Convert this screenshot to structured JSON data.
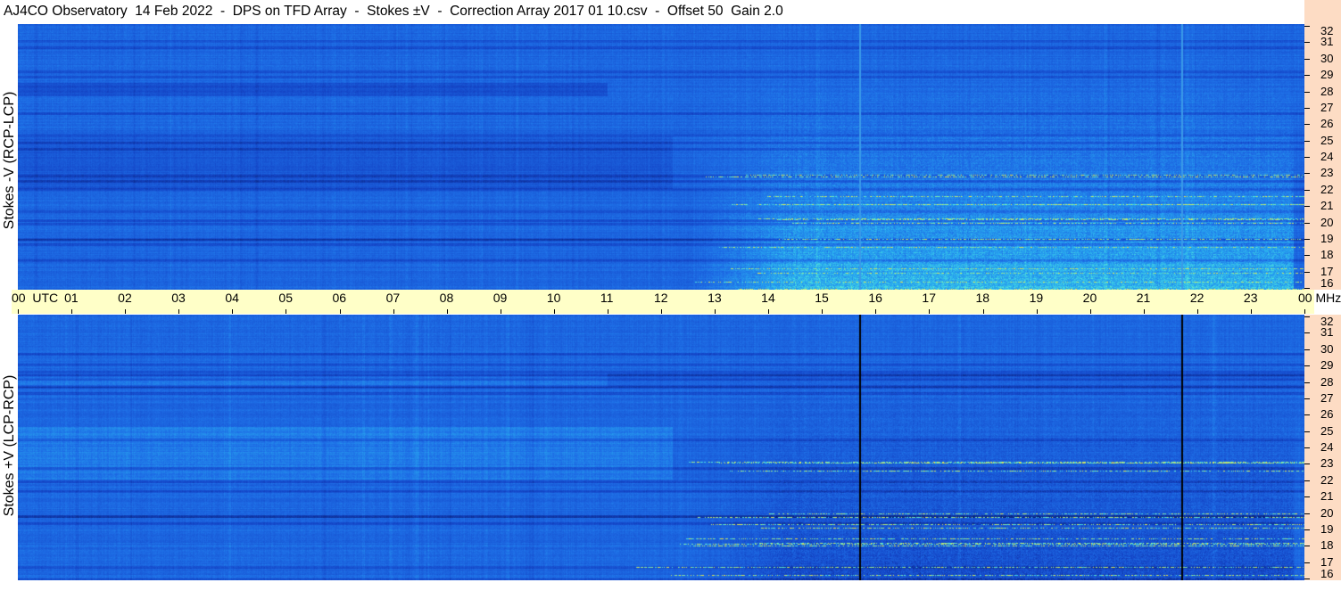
{
  "title": "AJ4CO Observatory  14 Feb 2022  -  DPS on TFD Array  -  Stokes ±V  -  Correction Array 2017 01 10.csv  -  Offset 50  Gain 2.0",
  "colors": {
    "background_blue": "#1a5ad8",
    "time_axis_bg": "#ffffc8",
    "freq_axis_bg": "#fddcc4"
  },
  "time_axis": {
    "labels": [
      "00  UTC",
      "01",
      "02",
      "03",
      "04",
      "05",
      "06",
      "07",
      "08",
      "09",
      "10",
      "11",
      "12",
      "13",
      "14",
      "15",
      "16",
      "17",
      "18",
      "19",
      "20",
      "21",
      "22",
      "23",
      "00 MHz"
    ]
  },
  "chart_data": [
    {
      "type": "heatmap",
      "ylabel": "Stokes -V (RCP-LCP)",
      "x_unit": "UTC hour",
      "x_range": [
        0,
        24
      ],
      "y_unit": "MHz",
      "y_range": [
        16,
        32
      ],
      "y_ticks": [
        "32",
        "31",
        "30",
        "29",
        "28",
        "27",
        "26",
        "25",
        "24",
        "23",
        "22",
        "21",
        "20",
        "19",
        "18",
        "17",
        "16"
      ],
      "vertical_lines_utc": [
        15.7,
        21.7
      ]
    },
    {
      "type": "heatmap",
      "ylabel": "Stokes +V (LCP-RCP)",
      "x_unit": "UTC hour",
      "x_range": [
        0,
        24
      ],
      "y_unit": "MHz",
      "y_range": [
        16,
        32
      ],
      "y_ticks": [
        "32",
        "31",
        "30",
        "29",
        "28",
        "27",
        "26",
        "25",
        "24",
        "23",
        "22",
        "21",
        "20",
        "19",
        "18",
        "17",
        "16"
      ],
      "vertical_lines_utc": [
        15.7,
        21.7
      ]
    }
  ]
}
